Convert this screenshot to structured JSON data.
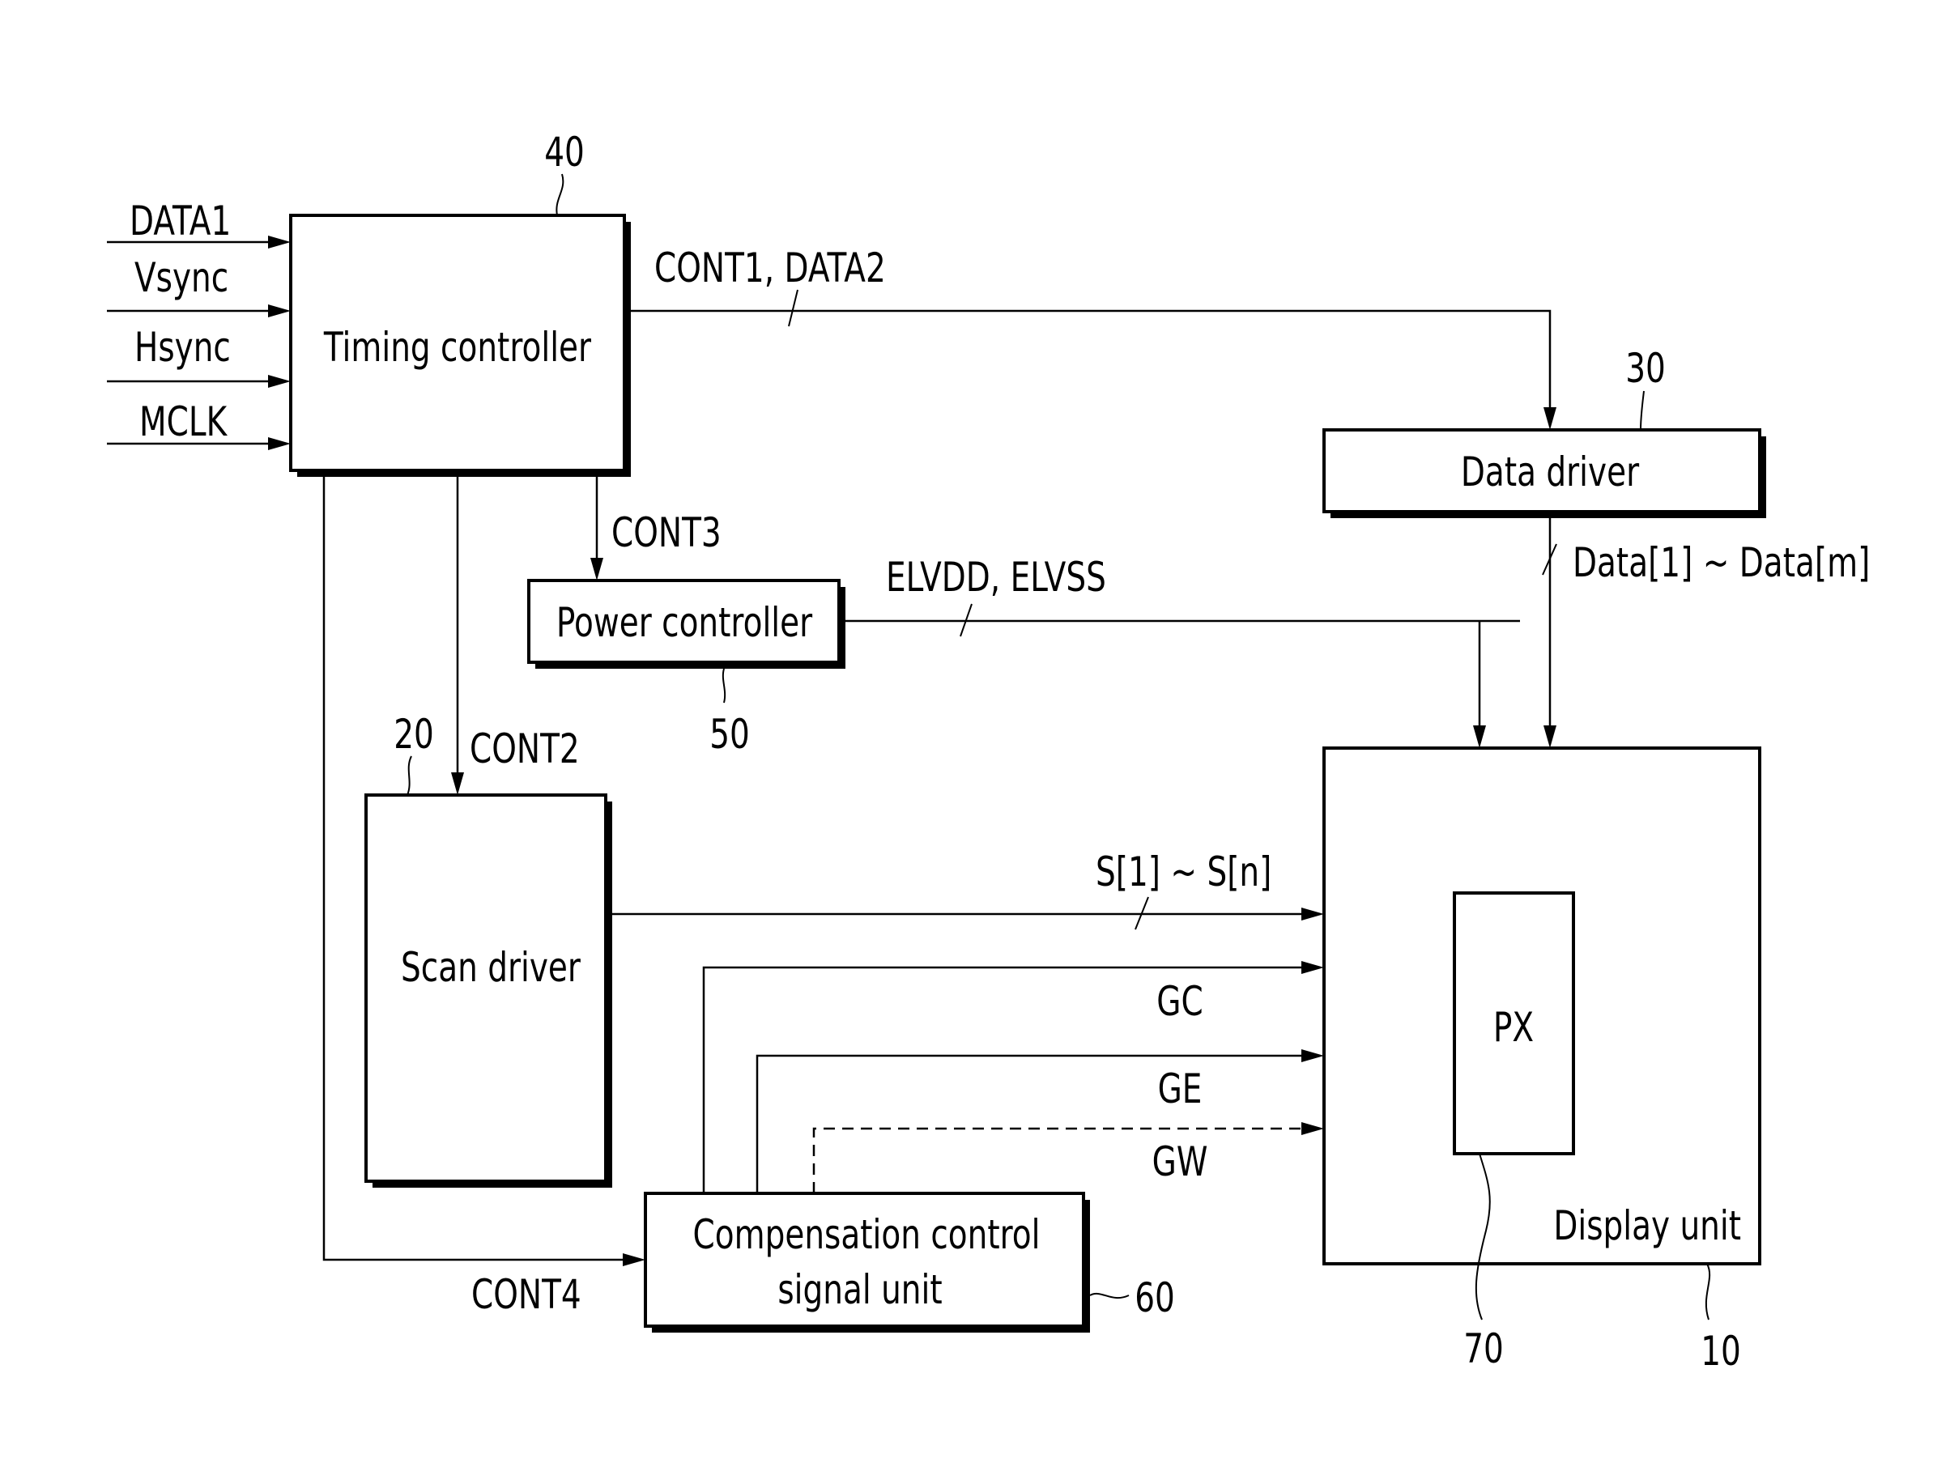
{
  "diagram": {
    "blocks": {
      "timing_controller": {
        "label": "Timing controller",
        "ref": "40"
      },
      "data_driver": {
        "label": "Data driver",
        "ref": "30"
      },
      "power_controller": {
        "label": "Power controller",
        "ref": "50"
      },
      "scan_driver": {
        "label": "Scan driver",
        "ref": "20"
      },
      "compensation": {
        "label_line1": "Compensation control",
        "label_line2": "signal unit",
        "ref": "60"
      },
      "display_unit": {
        "label": "Display unit",
        "ref": "10"
      },
      "pixel": {
        "label": "PX",
        "ref": "70"
      }
    },
    "inputs": [
      "DATA1",
      "Vsync",
      "Hsync",
      "MCLK"
    ],
    "signals": {
      "cont1_data2": "CONT1, DATA2",
      "cont2": "CONT2",
      "cont3": "CONT3",
      "cont4": "CONT4",
      "elvdd_elvss": "ELVDD, ELVSS",
      "data_lines": "Data[1] ~ Data[m]",
      "scan_lines": "S[1] ~ S[n]",
      "gc": "GC",
      "ge": "GE",
      "gw": "GW"
    }
  }
}
